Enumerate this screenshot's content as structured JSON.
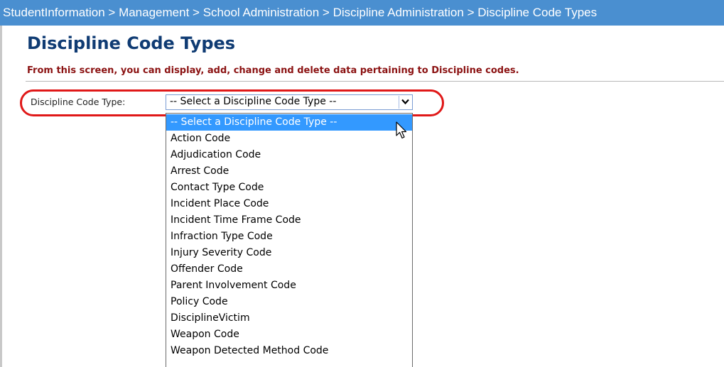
{
  "breadcrumb": {
    "items": [
      "StudentInformation",
      "Management",
      "School Administration",
      "Discipline Administration",
      "Discipline Code Types"
    ],
    "separator": ">"
  },
  "page": {
    "title": "Discipline Code Types",
    "subtitle": "From this screen, you can display, add, change and delete data pertaining to Discipline codes."
  },
  "form": {
    "label": "Discipline Code Type:",
    "selected_value": "-- Select a Discipline Code Type --",
    "options": [
      "-- Select a Discipline Code Type --",
      "Action Code",
      "Adjudication Code",
      "Arrest Code",
      "Contact Type Code",
      "Incident Place Code",
      "Incident Time Frame Code",
      "Infraction Type Code",
      "Injury Severity Code",
      "Offender Code",
      "Parent Involvement Code",
      "Policy Code",
      "DisciplineVictim",
      "Weapon Code",
      "Weapon Detected Method Code"
    ],
    "highlighted_option_index": 0
  },
  "icons": {
    "dropdown_arrow": "chevron-down-icon",
    "cursor": "mouse-pointer-icon"
  },
  "colors": {
    "breadcrumb_bg": "#4a8fd0",
    "title": "#0f3b73",
    "subtitle": "#8b1212",
    "highlight_oval": "#e01818",
    "selected_option_bg": "#3399ff"
  }
}
